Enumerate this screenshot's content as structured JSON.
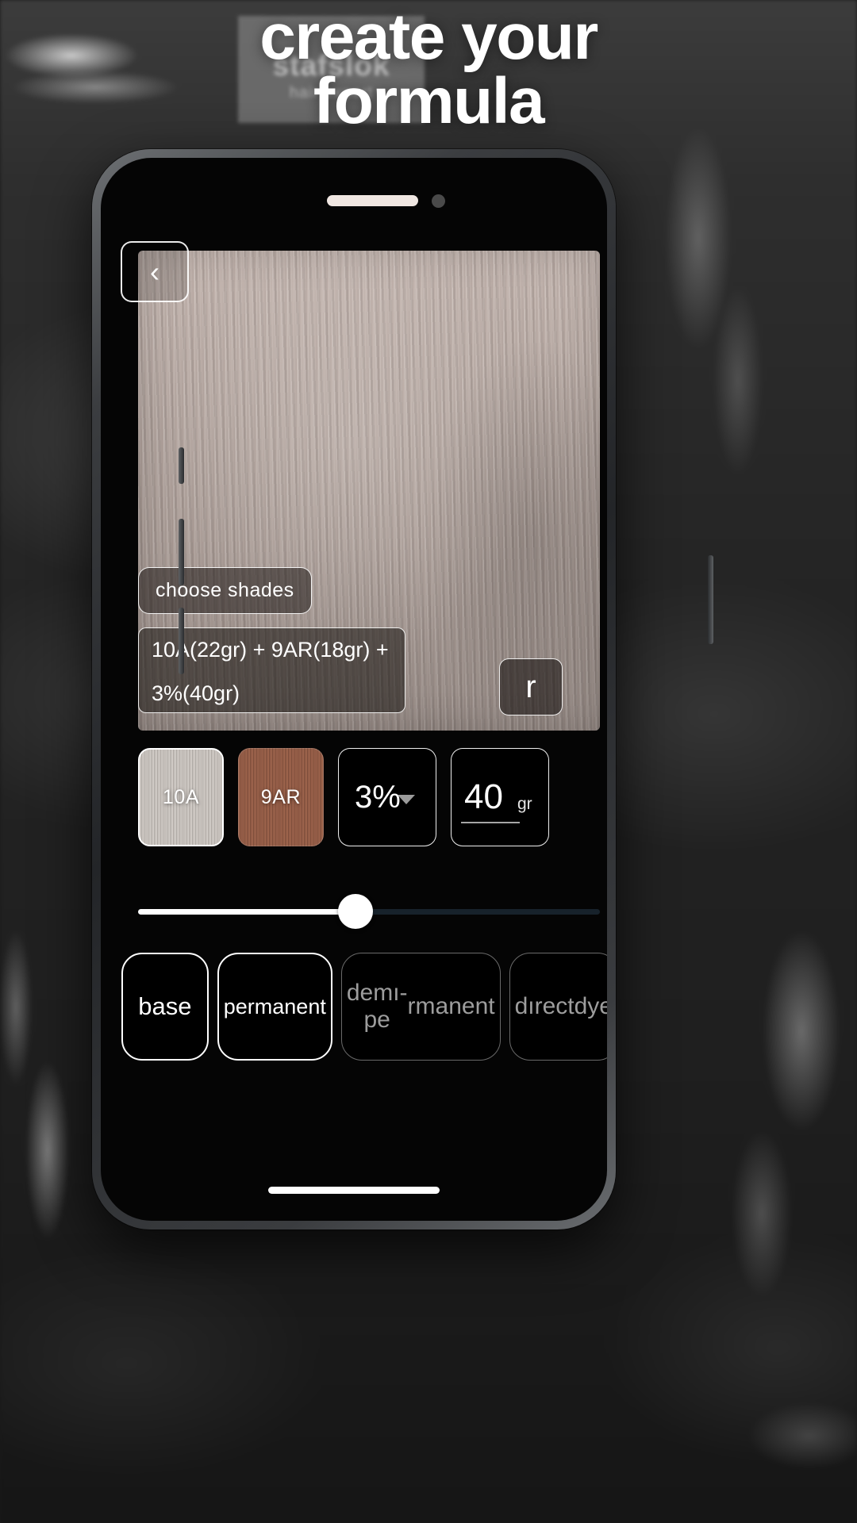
{
  "headline": {
    "line1": "create your",
    "line2": "formula"
  },
  "background_card": {
    "brand": "stafslok",
    "tagline": "hair expert"
  },
  "phone": {
    "back_button": {
      "icon": "chevron-left-icon",
      "glyph": "‹"
    },
    "preview": {
      "choose_shades_label": "choose  shades",
      "formula_text": "10A(22gr) + 9AR(18gr) + 3%(40gr)",
      "reset_button_label": "r"
    },
    "selector_row": {
      "shade_1": {
        "label": "10A",
        "color": "#c3bdb8"
      },
      "shade_2": {
        "label": "9AR",
        "color": "#8d5a45"
      },
      "developer": {
        "value": "3%",
        "icon": "chevron-down-icon"
      },
      "amount": {
        "value": "40",
        "unit": "gr"
      }
    },
    "slider": {
      "value_percent": 47,
      "fill_color": "#ffffff",
      "track_color": "#17222b"
    },
    "type_buttons": [
      {
        "label": "base",
        "state": "bright"
      },
      {
        "label": "permanent",
        "state": "bright"
      },
      {
        "label": "demı-pe\nrmanent",
        "state": "dim"
      },
      {
        "label": "dırect\ndye",
        "state": "dim"
      }
    ]
  }
}
